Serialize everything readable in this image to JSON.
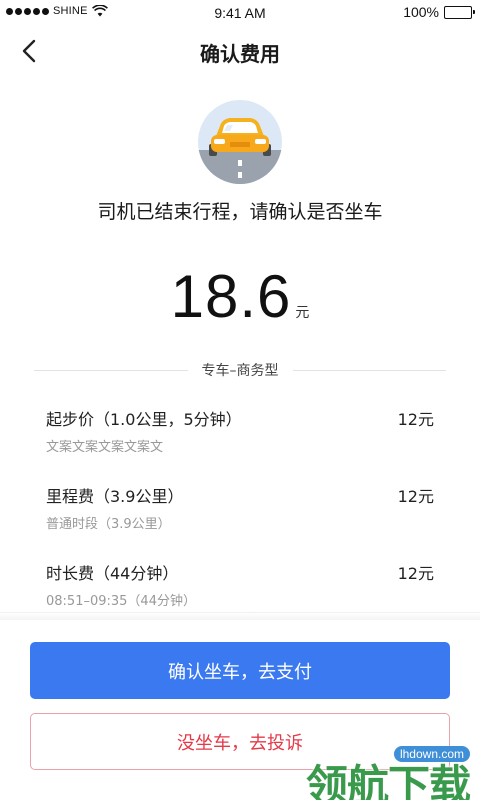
{
  "status_bar": {
    "carrier": "SHINE",
    "time": "9:41 AM",
    "battery": "100%",
    "battery_level": 1.0
  },
  "nav": {
    "title": "确认费用",
    "back_icon": "chevron-left-icon"
  },
  "trip": {
    "avatar_icon": "car-icon",
    "message": "司机已结束行程，请确认是否坐车"
  },
  "fare": {
    "amount": "18.6",
    "unit": "元"
  },
  "service_type": "专车–商务型",
  "fees": [
    {
      "name": "起步价（1.0公里，5分钟）",
      "amount": "12元",
      "desc": "文案文案文案文案文"
    },
    {
      "name": "里程费（3.9公里）",
      "amount": "12元",
      "desc": "普通时段（3.9公里）"
    },
    {
      "name": "时长费（44分钟）",
      "amount": "12元",
      "desc": "08:51–09:35（44分钟）"
    }
  ],
  "actions": {
    "confirm_label": "确认坐车，去支付",
    "complain_label": "没坐车，去投诉"
  },
  "colors": {
    "primary": "#3b79f0",
    "danger": "#e33a48"
  },
  "watermark": {
    "site": "lhdown.com",
    "text": "领航下载"
  }
}
